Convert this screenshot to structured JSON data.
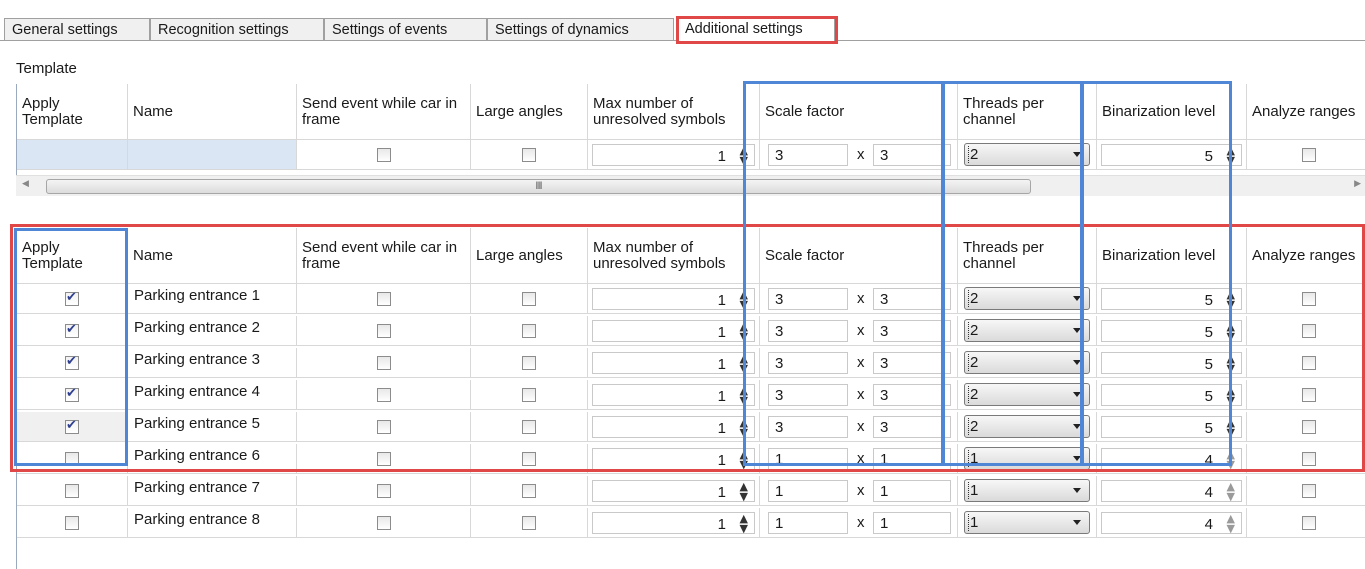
{
  "tabs": [
    "General settings",
    "Recognition settings",
    "Settings of events",
    "Settings of dynamics",
    "Additional settings"
  ],
  "active_tab": "Additional settings",
  "template_label": "Template",
  "columns": {
    "apply_template": "Apply Template",
    "name": "Name",
    "send_event": "Send event while car in frame",
    "large_angles": "Large angles",
    "max_unresolved": "Max number of unresolved symbols",
    "scale_factor": "Scale factor",
    "threads": "Threads per channel",
    "binarization": "Binarization level",
    "analyze_ranges": "Analyze ranges"
  },
  "template_row": {
    "send_event": false,
    "large_angles": false,
    "max_unresolved": "1",
    "scale_x": "3",
    "scale_y": "3",
    "threads": "2",
    "binarization": "5",
    "analyze_ranges": false
  },
  "scale_sep": "x",
  "scroll_grip": "III",
  "rows": [
    {
      "apply": true,
      "name": "Parking entrance 1",
      "send_event": false,
      "large_angles": false,
      "max_unresolved": "1",
      "scale_x": "3",
      "scale_y": "3",
      "threads": "2",
      "binarization": "5",
      "analyze_ranges": false
    },
    {
      "apply": true,
      "name": "Parking entrance 2",
      "send_event": false,
      "large_angles": false,
      "max_unresolved": "1",
      "scale_x": "3",
      "scale_y": "3",
      "threads": "2",
      "binarization": "5",
      "analyze_ranges": false
    },
    {
      "apply": true,
      "name": "Parking entrance 3",
      "send_event": false,
      "large_angles": false,
      "max_unresolved": "1",
      "scale_x": "3",
      "scale_y": "3",
      "threads": "2",
      "binarization": "5",
      "analyze_ranges": false
    },
    {
      "apply": true,
      "name": "Parking entrance 4",
      "send_event": false,
      "large_angles": false,
      "max_unresolved": "1",
      "scale_x": "3",
      "scale_y": "3",
      "threads": "2",
      "binarization": "5",
      "analyze_ranges": false
    },
    {
      "apply": true,
      "name": "Parking entrance 5",
      "send_event": false,
      "large_angles": false,
      "max_unresolved": "1",
      "scale_x": "3",
      "scale_y": "3",
      "threads": "2",
      "binarization": "5",
      "analyze_ranges": false
    },
    {
      "apply": false,
      "name": "Parking entrance 6",
      "send_event": false,
      "large_angles": false,
      "max_unresolved": "1",
      "scale_x": "1",
      "scale_y": "1",
      "threads": "1",
      "binarization": "4",
      "analyze_ranges": false
    },
    {
      "apply": false,
      "name": "Parking entrance 7",
      "send_event": false,
      "large_angles": false,
      "max_unresolved": "1",
      "scale_x": "1",
      "scale_y": "1",
      "threads": "1",
      "binarization": "4",
      "analyze_ranges": false
    },
    {
      "apply": false,
      "name": "Parking entrance 8",
      "send_event": false,
      "large_angles": false,
      "max_unresolved": "1",
      "scale_x": "1",
      "scale_y": "1",
      "threads": "1",
      "binarization": "4",
      "analyze_ranges": false
    }
  ],
  "highlight_colors": {
    "red": "#e04848",
    "blue": "#4f86d6"
  }
}
